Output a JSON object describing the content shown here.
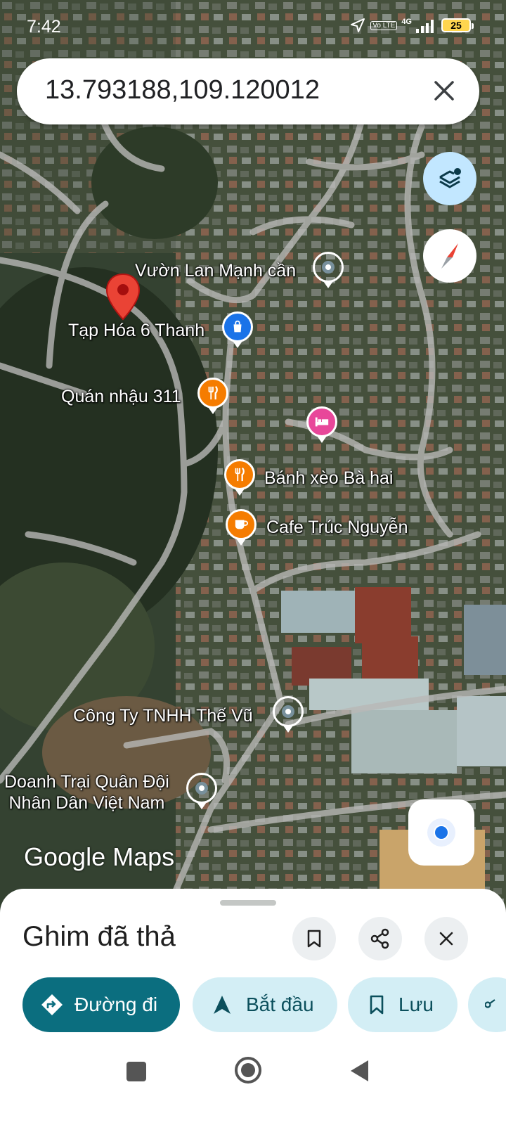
{
  "status_bar": {
    "time": "7:42",
    "network": "4G",
    "volte": "Vo LTE",
    "battery": "25"
  },
  "search": {
    "query": "13.793188,109.120012"
  },
  "map": {
    "branding": "Google Maps",
    "dropped_pin": "dropped-pin",
    "places": [
      {
        "name": "Vườn Lan Mạnh cần",
        "category": "generic",
        "color": "#78909c"
      },
      {
        "name": "Tạp Hóa 6 Thanh",
        "category": "shopping",
        "color": "#1a73e8"
      },
      {
        "name": "Quán nhậu 311",
        "category": "restaurant",
        "color": "#f57c00"
      },
      {
        "name": "",
        "category": "hotel",
        "color": "#e8479a"
      },
      {
        "name": "Bánh xèo Bà hai",
        "category": "restaurant",
        "color": "#f57c00"
      },
      {
        "name": "Cafe Trúc Nguyễn",
        "category": "cafe",
        "color": "#f57c00"
      },
      {
        "name": "Công Ty TNHH Thế Vũ",
        "category": "generic",
        "color": "#78909c"
      },
      {
        "name": "Doanh Trại Quân Đội\nNhân Dân Việt Nam",
        "category": "generic",
        "color": "#78909c"
      }
    ]
  },
  "sheet": {
    "title": "Ghim đã thả",
    "actions": {
      "directions": "Đường đi",
      "start": "Bắt đầu",
      "save": "Lưu"
    }
  },
  "colors": {
    "primary": "#0b6e7f",
    "secondary": "#d3eef5",
    "pin_red": "#ea4335"
  }
}
